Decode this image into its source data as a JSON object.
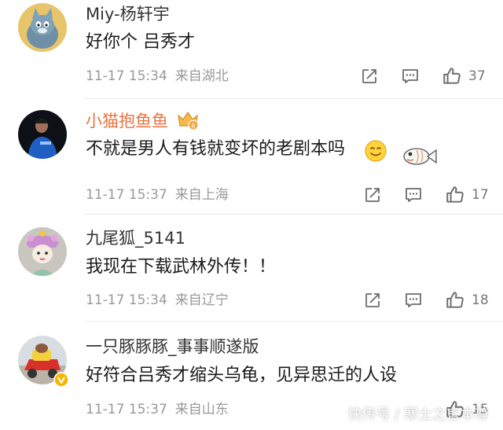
{
  "comments": [
    {
      "username": "Miy-杨轩宇",
      "text": "好你个 吕秀才",
      "time": "11-17 15:34",
      "location": "来自湖北",
      "likes": "37",
      "avatar_icon": "cartoon-cat-avatar"
    },
    {
      "username": "小猫抱鱼鱼",
      "text": "不就是男人有钱就变坏的老剧本吗",
      "time": "11-17 15:37",
      "location": "来自上海",
      "likes": "17",
      "avatar_icon": "athlete-photo-avatar",
      "badge_icon": "vip-crown-badge",
      "emoji_icon": "smile-emoji",
      "sticker_icon": "fish-sticker"
    },
    {
      "username": "九尾狐_5141",
      "text": "我现在下载武林外传！！",
      "time": "11-17 15:34",
      "location": "来自辽宁",
      "likes": "18",
      "avatar_icon": "opera-doll-avatar"
    },
    {
      "username": "一只豚豚豚_事事顺遂版",
      "text": "好符合吕秀才缩头乌龟，见异思迁的人设",
      "time": "11-17 15:37",
      "location": "来自山东",
      "likes": "15",
      "avatar_icon": "toy-car-avatar",
      "badge_icon": "verified-v-badge"
    }
  ],
  "watermark": "快传号 / 寒士之言本尊",
  "colors": {
    "vip_username": "#eb7340",
    "text": "#1a1a1a",
    "meta": "#999999",
    "icon": "#6b6b6b"
  }
}
